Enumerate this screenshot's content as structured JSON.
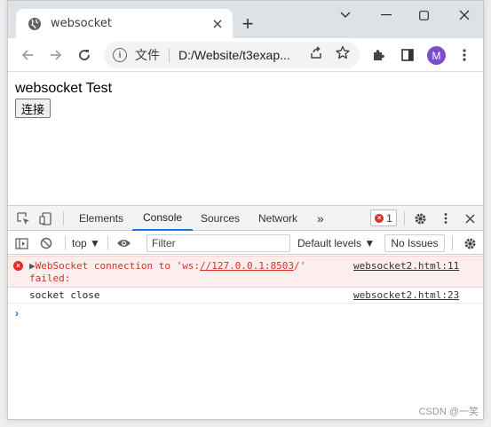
{
  "browser": {
    "tab_title": "websocket",
    "new_tab_symbol": "+",
    "omnibox": {
      "scheme_label": "文件",
      "url": "D:/Website/t3exap..."
    },
    "avatar_letter": "M"
  },
  "page": {
    "title": "websocket Test",
    "connect_button": "连接"
  },
  "devtools": {
    "tabs": [
      "Elements",
      "Console",
      "Sources",
      "Network"
    ],
    "more_tabs_symbol": "»",
    "active_tab": "Console",
    "error_count": "1",
    "context_select": "top",
    "filter_placeholder": "Filter",
    "levels_label": "Default levels ▼",
    "issues_label": "No Issues",
    "messages": {
      "error_line1_pre": "WebSocket connection to 'ws:",
      "error_line1_link": "//127.0.0.1:8503",
      "error_line1_post": "/'",
      "error_line2": "failed:",
      "error_source": "websocket2.html:11",
      "log_text": "socket close",
      "log_source": "websocket2.html:23"
    },
    "prompt_symbol": "›"
  },
  "watermark": "CSDN @一笑"
}
